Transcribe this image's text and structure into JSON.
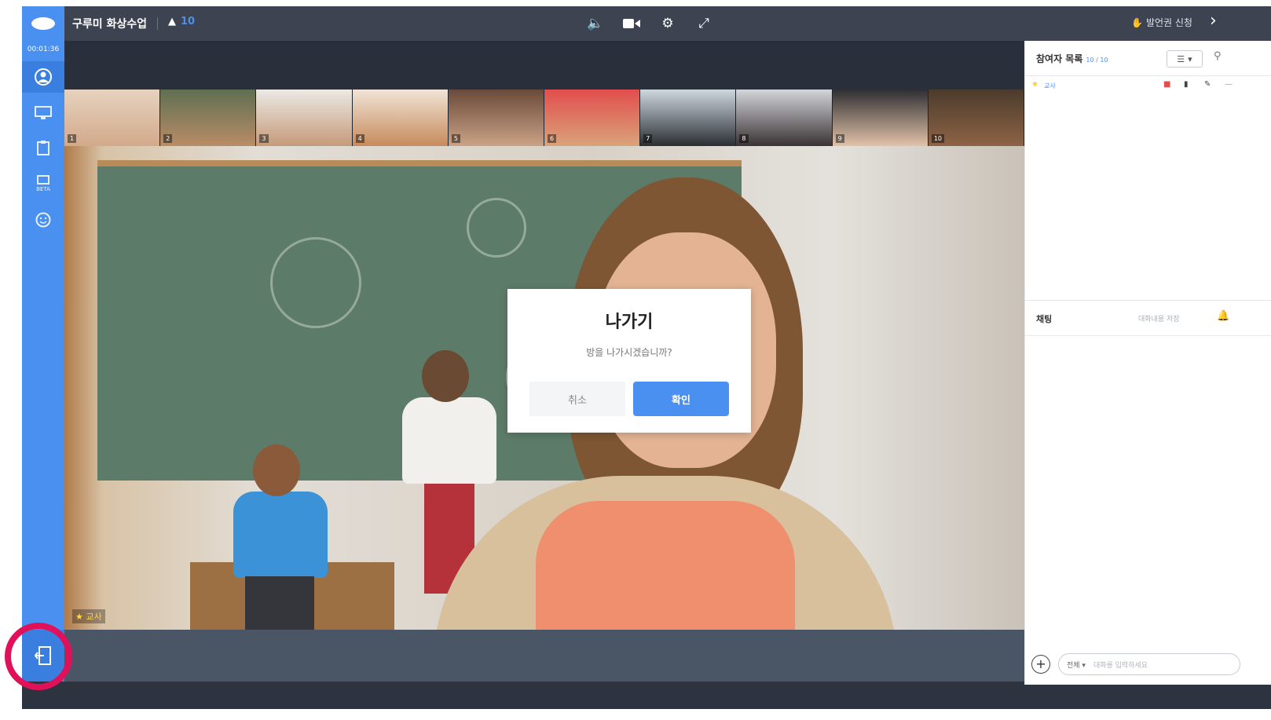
{
  "header": {
    "title": "구루미 화상수업",
    "participant_count": "10",
    "share_label": "발언권 신청"
  },
  "sidebar": {
    "timer": "00:01:36",
    "beta_label": "BETA"
  },
  "thumbnails": [
    {
      "tag": "1"
    },
    {
      "tag": "2"
    },
    {
      "tag": "3"
    },
    {
      "tag": "4"
    },
    {
      "tag": "5"
    },
    {
      "tag": "6"
    },
    {
      "tag": "7"
    },
    {
      "tag": "8"
    },
    {
      "tag": "9"
    },
    {
      "tag": "10"
    }
  ],
  "main_video": {
    "speaker_label": "교사"
  },
  "right_panel": {
    "participants_title": "참여자 목록",
    "participants_sub": "10 / 10",
    "self_name": "교사",
    "chat_title": "채팅",
    "chat_sub": "대화내용 저장",
    "chat_target": "전체",
    "chat_placeholder": "대화를 입력하세요"
  },
  "modal": {
    "title": "나가기",
    "message": "방을 나가시겠습니까?",
    "cancel": "취소",
    "confirm": "확인"
  },
  "colors": {
    "accent": "#4a90f0",
    "highlight_ring": "#e0115a",
    "topbar": "#3d4350"
  },
  "icons": {
    "logo": "eye-logo",
    "speaker": "speaker-icon",
    "camera": "camera-icon",
    "settings": "gear-icon",
    "fullscreen": "expand-icon",
    "exit": "exit-icon"
  }
}
